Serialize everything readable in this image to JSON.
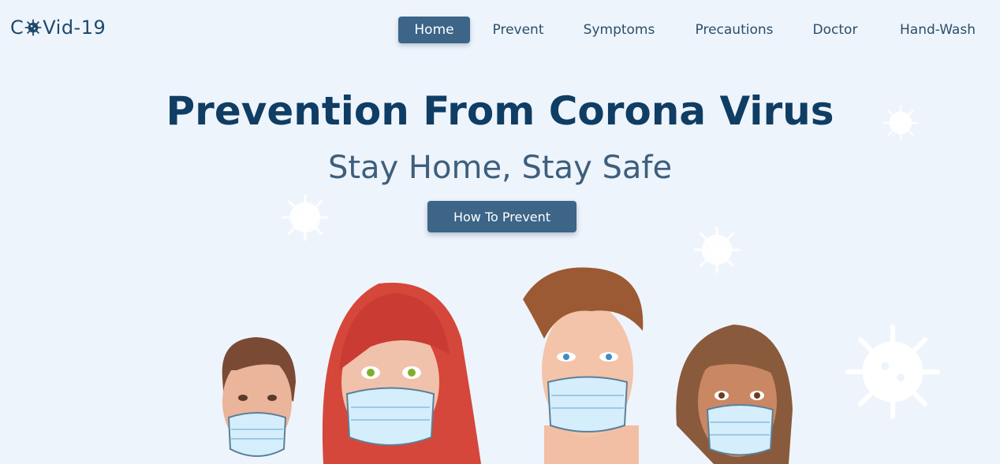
{
  "logo": {
    "prefix": "C",
    "suffix": "Vid-19",
    "icon": "coronavirus-icon"
  },
  "nav": {
    "items": [
      {
        "label": "Home",
        "active": true
      },
      {
        "label": "Prevent",
        "active": false
      },
      {
        "label": "Symptoms",
        "active": false
      },
      {
        "label": "Precautions",
        "active": false
      },
      {
        "label": "Doctor",
        "active": false
      },
      {
        "label": "Hand-Wash",
        "active": false
      }
    ]
  },
  "hero": {
    "title": "Prevention From Corona Virus",
    "subtitle": "Stay Home, Stay Safe",
    "cta_label": "How To Prevent",
    "illustration": "four-people-wearing-face-masks"
  },
  "colors": {
    "background": "#eef4fc",
    "accent": "#3c6587",
    "title": "#0f3d63"
  }
}
